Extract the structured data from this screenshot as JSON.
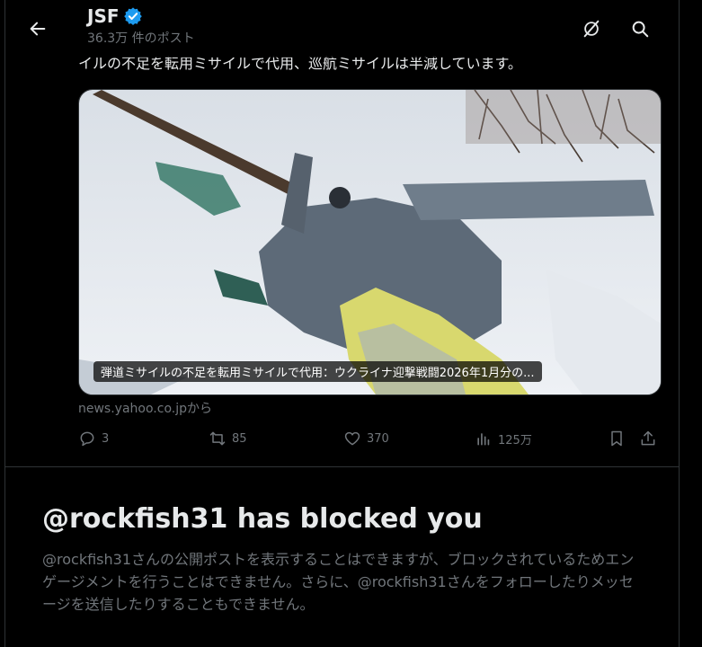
{
  "header": {
    "title": "JSF",
    "post_count": "36.3万 件のポスト"
  },
  "tweet": {
    "text": "イルの不足を転用ミサイルで代用、巡航ミサイルは半減しています。",
    "card": {
      "title": "弾道ミサイルの不足を転用ミサイルで代用：ウクライナ迎撃戦闘2026年1月分の...",
      "source": "news.yahoo.co.jpから"
    },
    "actions": {
      "replies": "3",
      "reposts": "85",
      "likes": "370",
      "views": "125万"
    }
  },
  "blocked": {
    "title": "@rockfish31 has blocked you",
    "body": "@rockfish31さんの公開ポストを表示することはできますが、ブロックされているためエンゲージメントを行うことはできません。さらに、@rockfish31さんをフォローしたりメッセージを送信したりすることもできません。"
  },
  "colors": {
    "background": "#000000",
    "text": "#e7e9ea",
    "muted": "#71767b",
    "verified": "#1d9bf0",
    "border": "#2f3336"
  },
  "icons": [
    "back-arrow-icon",
    "verified-badge-icon",
    "grok-icon",
    "search-icon",
    "reply-icon",
    "repost-icon",
    "like-icon",
    "views-icon",
    "bookmark-icon",
    "share-icon"
  ]
}
